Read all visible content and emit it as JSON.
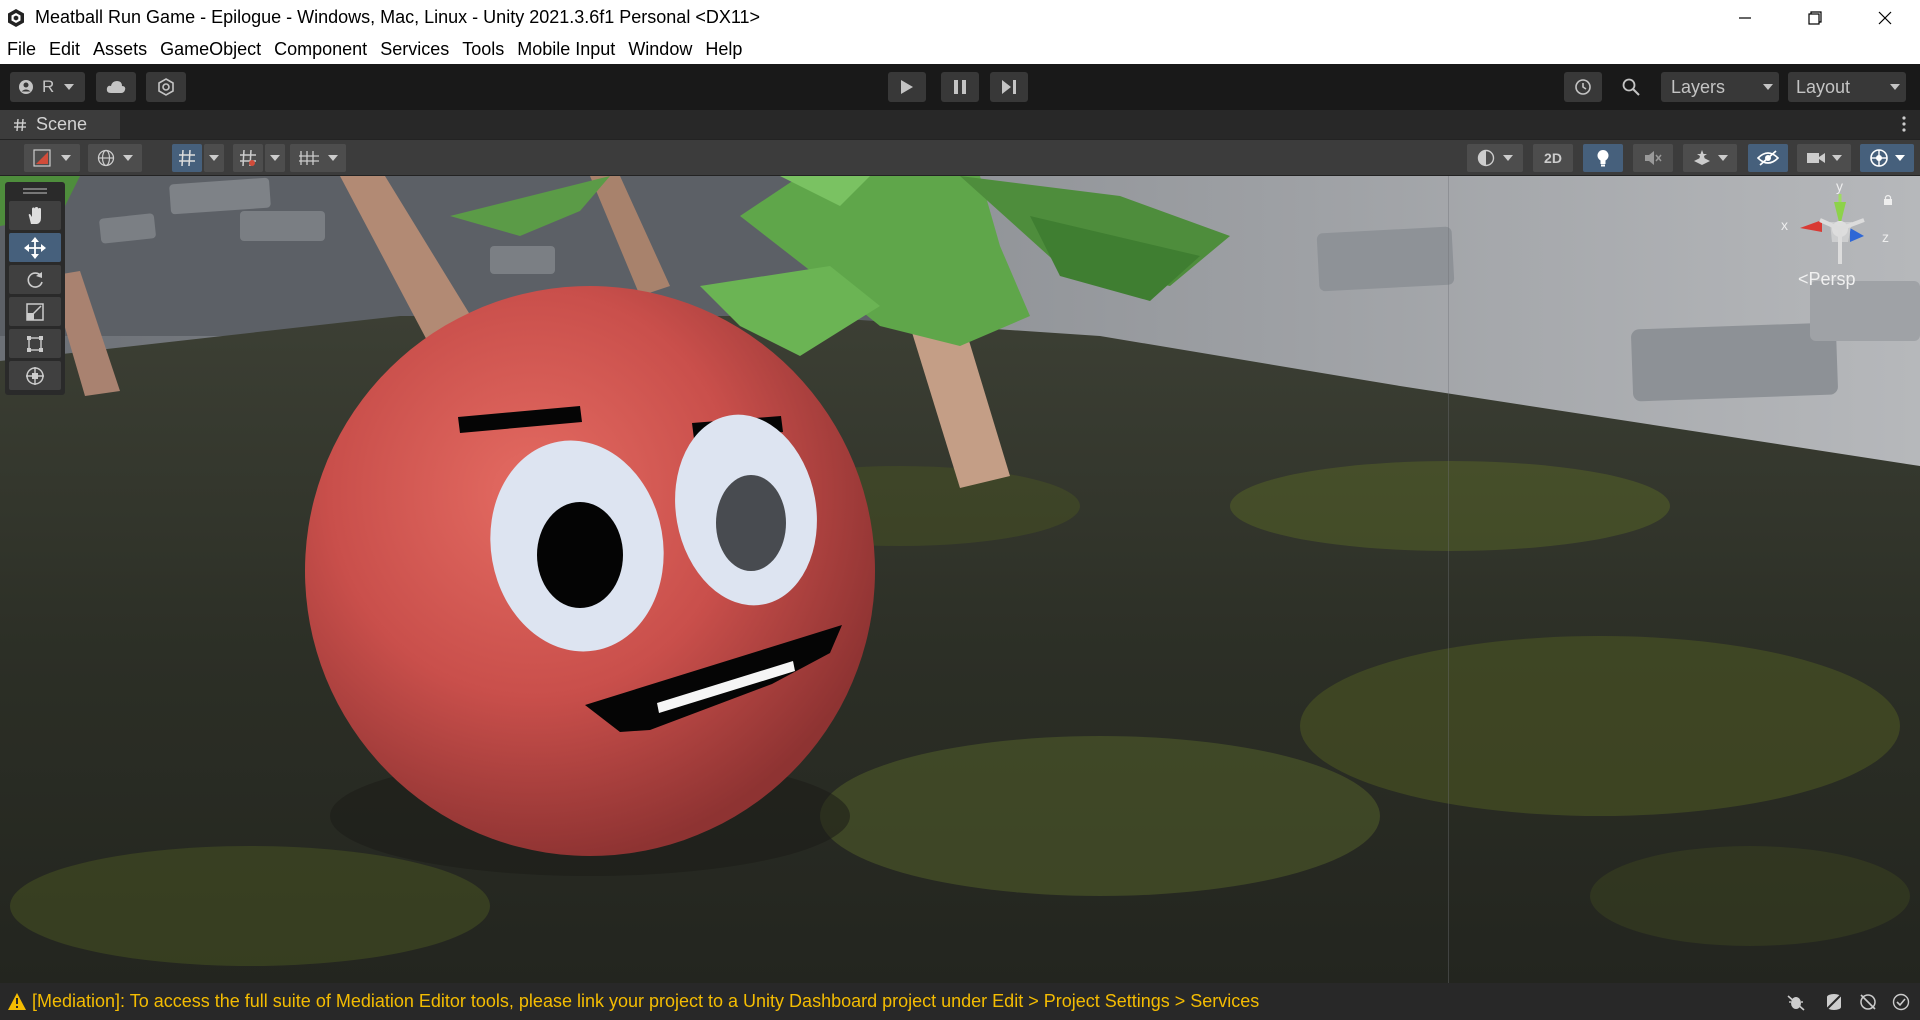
{
  "window": {
    "title": "Meatball Run Game - Epilogue - Windows, Mac, Linux - Unity 2021.3.6f1 Personal <DX11>"
  },
  "menu": [
    "File",
    "Edit",
    "Assets",
    "GameObject",
    "Component",
    "Services",
    "Tools",
    "Mobile Input",
    "Window",
    "Help"
  ],
  "toolbar": {
    "account_label": "R",
    "layers_label": "Layers",
    "layout_label": "Layout"
  },
  "scene_tab": {
    "label": "Scene"
  },
  "scene_toolbar": {
    "mode_2d_label": "2D"
  },
  "gizmo": {
    "y_label": "y",
    "x_label": "x",
    "z_label": "z",
    "projection_label": "<Persp"
  },
  "tools": [
    "hand-tool",
    "move-tool",
    "rotate-tool",
    "scale-tool",
    "rect-tool",
    "transform-tool"
  ],
  "active_tool": "move-tool",
  "status": {
    "message": "[Mediation]: To access the full suite of Mediation Editor tools, please link your project to a Unity Dashboard project under Edit > Project Settings > Services"
  },
  "colors": {
    "accent": "#46607c",
    "warning": "#f4bc02",
    "panel": "#3c3c3c"
  }
}
